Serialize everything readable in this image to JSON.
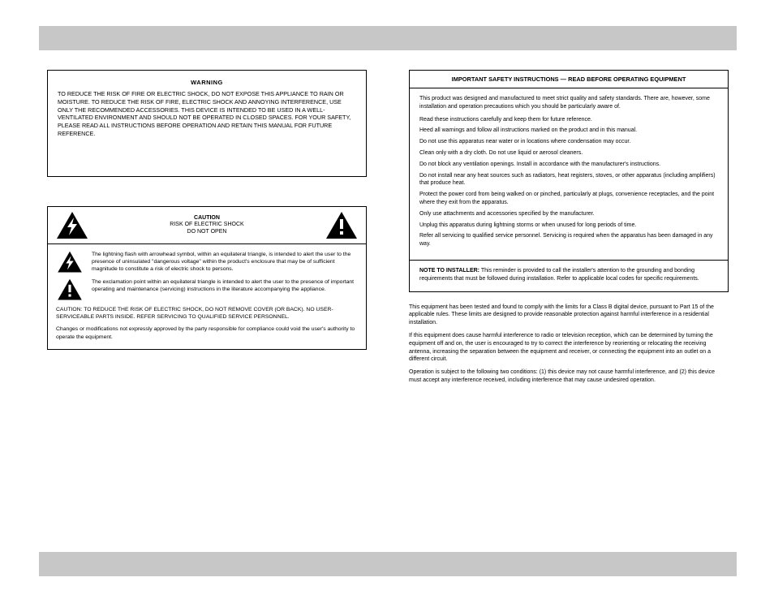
{
  "warning_box": {
    "title": "WARNING",
    "text": "TO REDUCE THE RISK OF FIRE OR ELECTRIC SHOCK, DO NOT EXPOSE THIS APPLIANCE TO RAIN OR MOISTURE. TO REDUCE THE RISK OF FIRE, ELECTRIC SHOCK AND ANNOYING INTERFERENCE, USE ONLY THE RECOMMENDED ACCESSORIES. THIS DEVICE IS INTENDED TO BE USED IN A WELL-VENTILATED ENVIRONMENT AND SHOULD NOT BE OPERATED IN CLOSED SPACES. FOR YOUR SAFETY, PLEASE READ ALL INSTRUCTIONS BEFORE OPERATION AND RETAIN THIS MANUAL FOR FUTURE REFERENCE."
  },
  "caution_panel": {
    "head_line1": "CAUTION",
    "head_line2": "RISK OF ELECTRIC SHOCK",
    "head_line3": "DO NOT OPEN",
    "bolt_text": "The lightning flash with arrowhead symbol, within an equilateral triangle, is intended to alert the user to the presence of uninsulated \"dangerous voltage\" within the product's enclosure that may be of sufficient magnitude to constitute a risk of electric shock to persons.",
    "excl_text": "The exclamation point within an equilateral triangle is intended to alert the user to the presence of important operating and maintenance (servicing) instructions in the literature accompanying the appliance.",
    "plain1": "CAUTION: TO REDUCE THE RISK OF ELECTRIC SHOCK, DO NOT REMOVE COVER (OR BACK). NO USER-SERVICEABLE PARTS INSIDE. REFER SERVICING TO QUALIFIED SERVICE PERSONNEL.",
    "plain2": "Changes or modifications not expressly approved by the party responsible for compliance could void the user's authority to operate the equipment."
  },
  "right_box": {
    "title": "IMPORTANT SAFETY INSTRUCTIONS — READ BEFORE OPERATING EQUIPMENT",
    "intro": "This product was designed and manufactured to meet strict quality and safety standards. There are, however, some installation and operation precautions which you should be particularly aware of.",
    "items": [
      "Read these instructions carefully and keep them for future reference.",
      "Heed all warnings and follow all instructions marked on the product and in this manual.",
      "Do not use this apparatus near water or in locations where condensation may occur.",
      "Clean only with a dry cloth. Do not use liquid or aerosol cleaners.",
      "Do not block any ventilation openings. Install in accordance with the manufacturer's instructions.",
      "Do not install near any heat sources such as radiators, heat registers, stoves, or other apparatus (including amplifiers) that produce heat.",
      "Protect the power cord from being walked on or pinched, particularly at plugs, convenience receptacles, and the point where they exit from the apparatus.",
      "Only use attachments and accessories specified by the manufacturer.",
      "Unplug this apparatus during lightning storms or when unused for long periods of time.",
      "Refer all servicing to qualified service personnel. Servicing is required when the apparatus has been damaged in any way."
    ],
    "note_label": "NOTE TO INSTALLER:",
    "note_text": "This reminder is provided to call the installer's attention to the grounding and bonding requirements that must be followed during installation. Refer to applicable local codes for specific requirements."
  },
  "bottom_note": {
    "p1": "This equipment has been tested and found to comply with the limits for a Class B digital device, pursuant to Part 15 of the applicable rules. These limits are designed to provide reasonable protection against harmful interference in a residential installation.",
    "p2": "If this equipment does cause harmful interference to radio or television reception, which can be determined by turning the equipment off and on, the user is encouraged to try to correct the interference by reorienting or relocating the receiving antenna, increasing the separation between the equipment and receiver, or connecting the equipment into an outlet on a different circuit.",
    "p3": "Operation is subject to the following two conditions: (1) this device may not cause harmful interference, and (2) this device must accept any interference received, including interference that may cause undesired operation."
  }
}
